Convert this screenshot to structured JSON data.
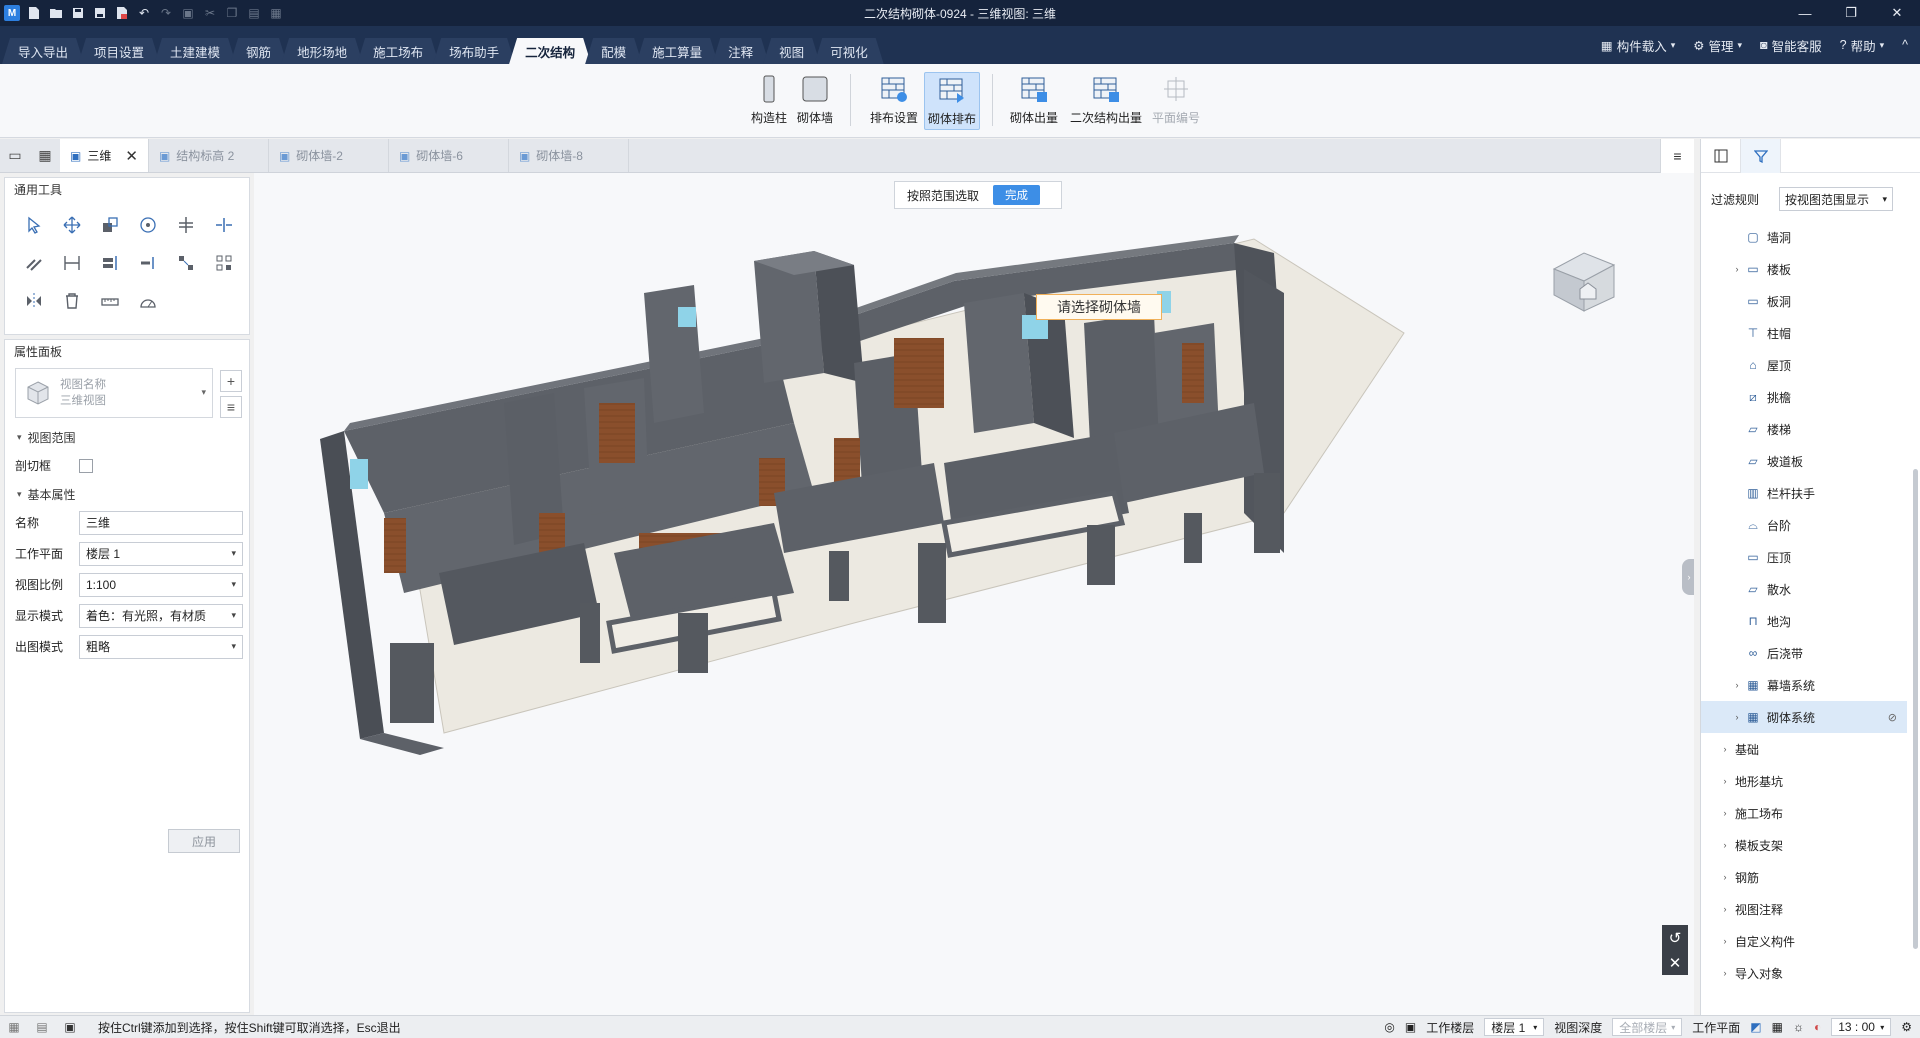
{
  "window": {
    "title": "二次结构砌体-0924 - 三维视图: 三维"
  },
  "ribbon_tabs": [
    "导入导出",
    "项目设置",
    "土建建模",
    "钢筋",
    "地形场地",
    "施工场布",
    "场布助手",
    "二次结构",
    "配模",
    "施工算量",
    "注释",
    "视图",
    "可视化"
  ],
  "ribbon_right": {
    "component_load": "构件载入",
    "manage": "管理",
    "service": "智能客服",
    "help": "帮助"
  },
  "ribbon_buttons": {
    "col": "构造柱",
    "wall": "砌体墙",
    "layout_set": "排布设置",
    "layout": "砌体排布",
    "out1": "砌体出量",
    "out2": "二次结构出量",
    "plan_no": "平面编号"
  },
  "doc_tabs": [
    "三维",
    "结构标高 2",
    "砌体墙-2",
    "砌体墙-6",
    "砌体墙-8"
  ],
  "tools_panel": {
    "title": "通用工具"
  },
  "props_panel": {
    "title": "属性面板",
    "view_name_placeholder": "视图名称",
    "view_name_value": "三维视图",
    "section_view_range": "视图范围",
    "section_box": "剖切框",
    "section_basic": "基本属性",
    "name_label": "名称",
    "name_value": "三维",
    "plane_label": "工作平面",
    "plane_value": "楼层 1",
    "scale_label": "视图比例",
    "scale_value": "1:100",
    "display_label": "显示模式",
    "display_value": "着色：有光照，有材质",
    "output_label": "出图模式",
    "output_value": "粗略",
    "apply": "应用"
  },
  "viewport": {
    "select_by_range": "按照范围选取",
    "done": "完成",
    "prompt": "请选择砌体墙"
  },
  "right_panel": {
    "filter_label": "过滤规则",
    "filter_value": "按视图范围显示",
    "items": [
      "墙洞",
      "楼板",
      "板洞",
      "柱帽",
      "屋顶",
      "挑檐",
      "楼梯",
      "坡道板",
      "栏杆扶手",
      "台阶",
      "压顶",
      "散水",
      "地沟",
      "后浇带",
      "幕墙系统",
      "砌体系统"
    ],
    "groups": [
      "基础",
      "地形基坑",
      "施工场布",
      "模板支架",
      "钢筋",
      "视图注释",
      "自定义构件",
      "导入对象"
    ]
  },
  "status": {
    "hint": "按住Ctrl键添加到选择，按住Shift键可取消选择，Esc退出",
    "floor_label": "工作楼层",
    "floor_value": "楼层 1",
    "depth_label": "视图深度",
    "depth_value": "全部楼层",
    "plane_label": "工作平面",
    "time": "13 : 00"
  },
  "colors": {
    "titlebar": "#15233c",
    "ribbon_tab": "#1f3252",
    "accent": "#3d8ee6",
    "wall": "#5d6168",
    "door": "#8a4f2c",
    "slab": "#efece4"
  }
}
